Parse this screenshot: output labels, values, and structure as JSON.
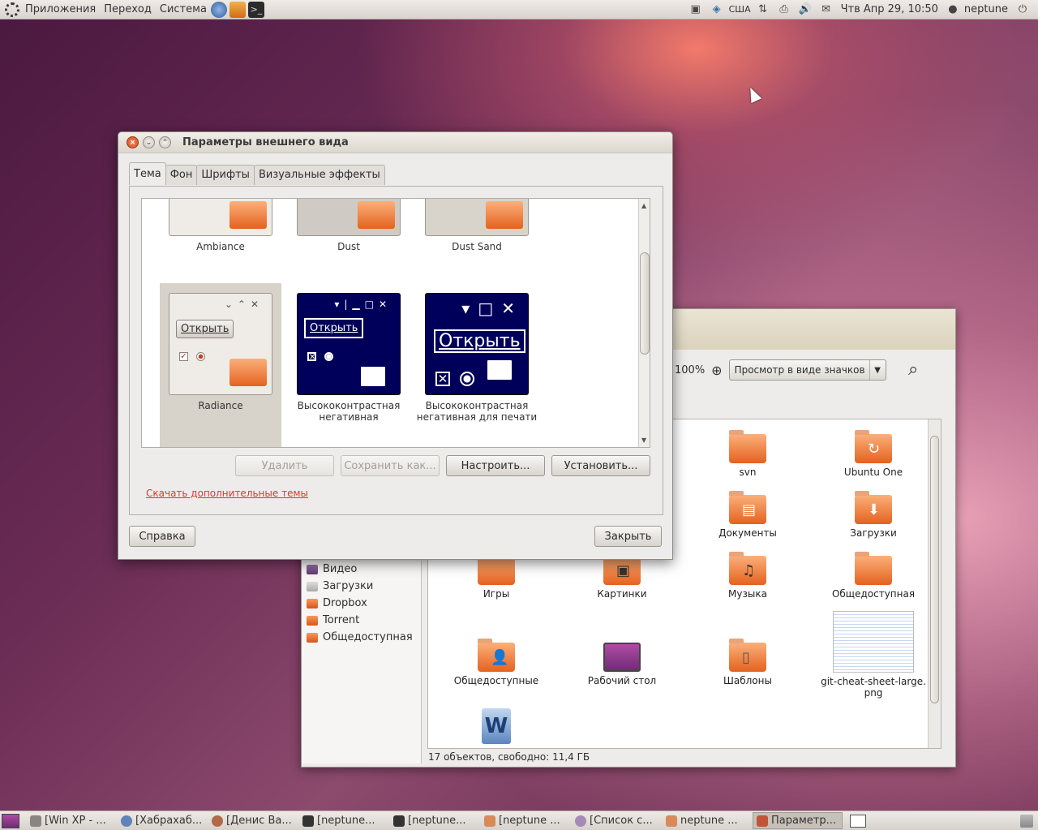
{
  "top_panel": {
    "menus": [
      "Приложения",
      "Переход",
      "Система"
    ],
    "keyboard_layout": "США",
    "clock": "Чтв Апр 29, 10:50",
    "user": "neptune"
  },
  "dialog": {
    "title": "Параметры внешнего вида",
    "tabs": [
      "Тема",
      "Фон",
      "Шрифты",
      "Визуальные эффекты"
    ],
    "themes": [
      {
        "name": "Ambiance"
      },
      {
        "name": "Dust"
      },
      {
        "name": "Dust Sand"
      },
      {
        "name": "Radiance",
        "preview_button": "Открыть"
      },
      {
        "name": "Высококонтрастная негативная",
        "preview_button": "Открыть"
      },
      {
        "name": "Высококонтрастная негативная для печати",
        "preview_button": "Открыть"
      }
    ],
    "buttons": {
      "delete": "Удалить",
      "save_as": "Сохранить как...",
      "customize": "Настроить...",
      "install": "Установить..."
    },
    "more_themes_link": "Скачать дополнительные темы",
    "help": "Справка",
    "close": "Закрыть"
  },
  "file_manager": {
    "zoom": "100%",
    "view_mode": "Просмотр в виде значков",
    "sidebar": [
      "Видео",
      "Загрузки",
      "Dropbox",
      "Torrent",
      "Общедоступная"
    ],
    "items": [
      {
        "name": "svn"
      },
      {
        "name": "Ubuntu One"
      },
      {
        "name": "Документы"
      },
      {
        "name": "Загрузки"
      },
      {
        "name": "Игры"
      },
      {
        "name": "Картинки"
      },
      {
        "name": "Музыка"
      },
      {
        "name": "Общедоступная"
      },
      {
        "name": "Общедоступные"
      },
      {
        "name": "Рабочий стол"
      },
      {
        "name": "Шаблоны"
      },
      {
        "name": "git-cheat-sheet-large.\npng"
      }
    ],
    "status": "17 объектов, свободно: 11,4 ГБ"
  },
  "taskbar": [
    "[Win XP - ...",
    "[Хабрахаб...",
    "[Денис Ва...",
    "[neptune...",
    "[neptune...",
    "[neptune ...",
    "[Список с...",
    "neptune ...",
    "Параметр..."
  ]
}
